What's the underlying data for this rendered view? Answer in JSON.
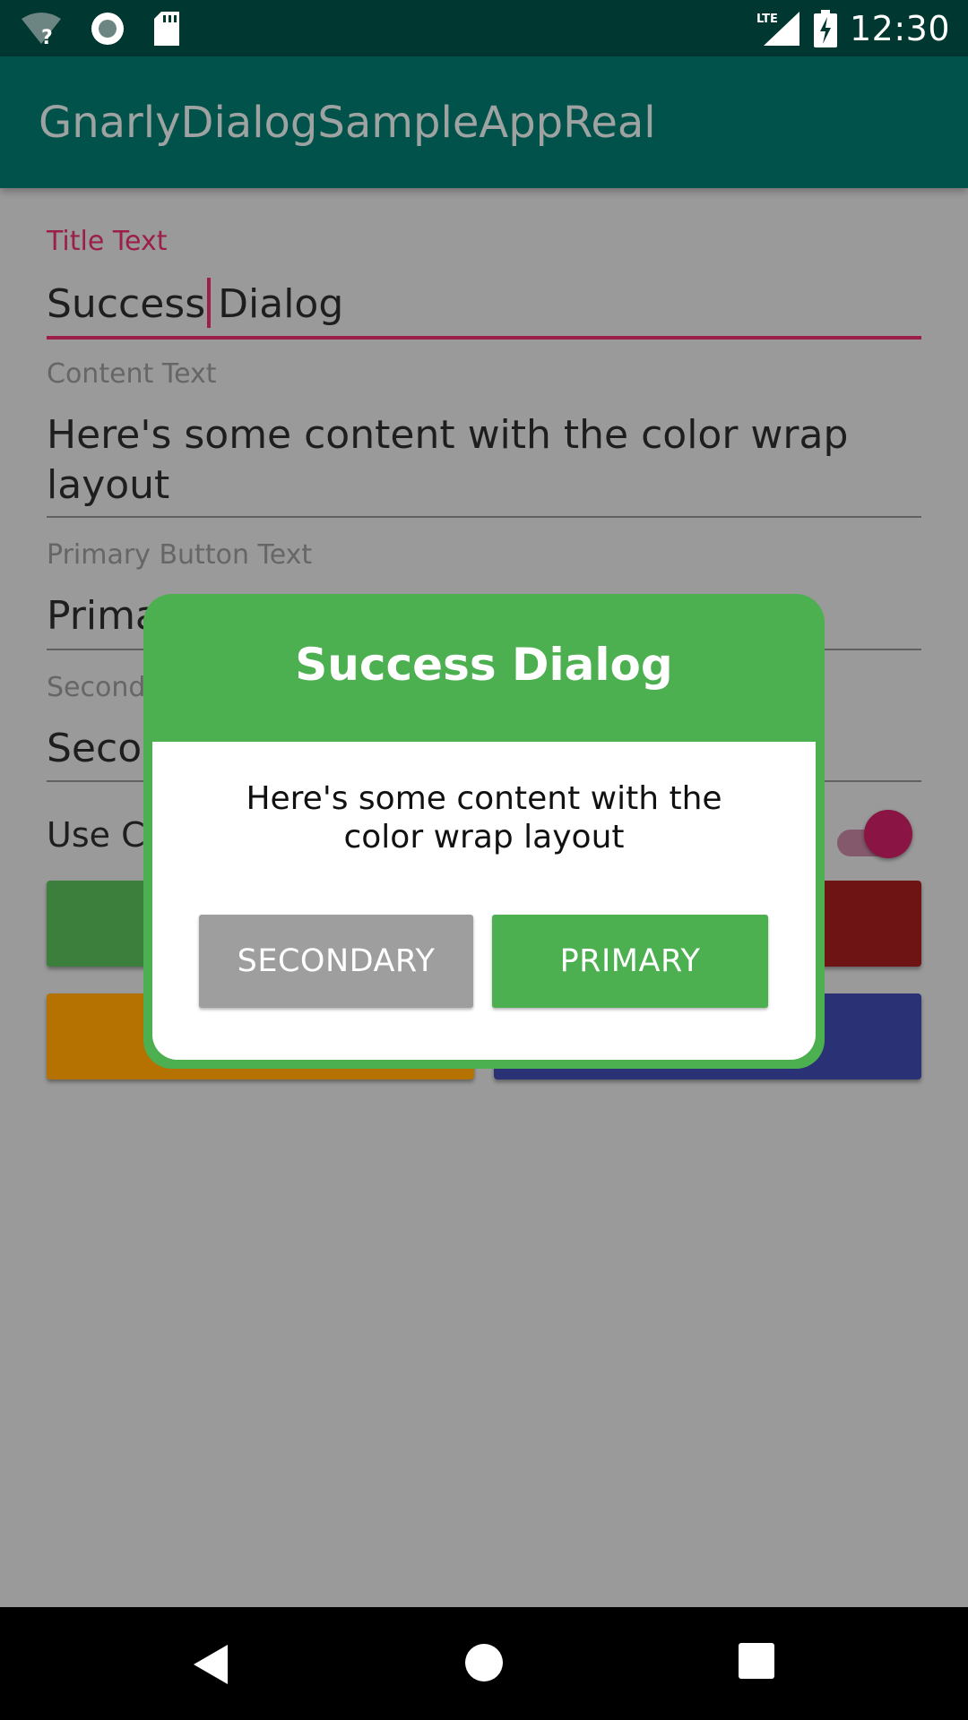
{
  "status_bar": {
    "time": "12:30",
    "network_label": "LTE",
    "icons": [
      "wifi-unknown-icon",
      "sync-icon",
      "sd-card-icon",
      "cell-signal-icon",
      "battery-charging-icon"
    ]
  },
  "app_bar": {
    "title": "GnarlyDialogSampleAppReal"
  },
  "form": {
    "title_label": "Title Text",
    "title_value_before_cursor": "Success",
    "title_value_after_cursor": "Dialog",
    "content_label": "Content Text",
    "content_value_line1": "Here's some content with the color wrap",
    "content_value_line2": "layout",
    "primary_label": "Primary Button Text",
    "primary_value_visible": "Prima",
    "secondary_label_visible": "Second",
    "secondary_value_visible": "Seco",
    "toggle_label_visible": "Use Co",
    "toggle_on": true
  },
  "background_buttons": {
    "colors": [
      "#3c7e3c",
      "#6e1414",
      "#b57200",
      "#2b3175"
    ]
  },
  "dialog": {
    "title": "Success Dialog",
    "content": "Here's some content with the color wrap layout",
    "secondary_button": "SECONDARY",
    "primary_button": "PRIMARY",
    "accent_color": "#4caf50"
  },
  "colors": {
    "accent": "#9b1f4a",
    "app_bar": "#00524a",
    "status_bar": "#003731"
  },
  "nav_bar": {
    "icons": [
      "back-icon",
      "home-icon",
      "recents-icon"
    ]
  }
}
